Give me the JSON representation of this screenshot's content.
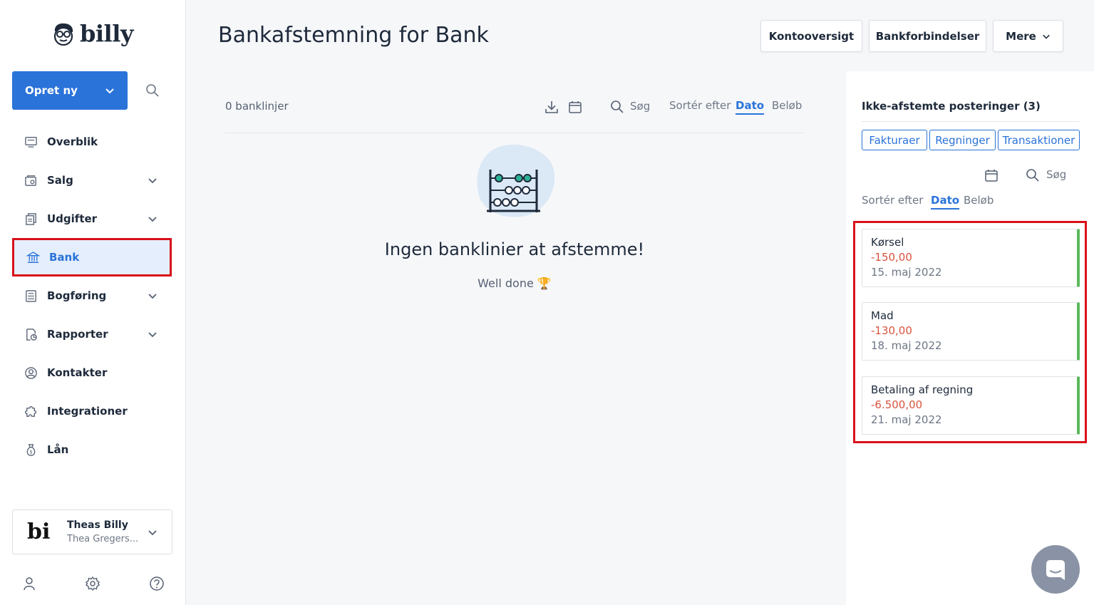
{
  "brand": {
    "name": "billy"
  },
  "sidebar": {
    "create_label": "Opret ny",
    "items": [
      {
        "label": "Overblik",
        "icon": "dashboard-icon",
        "expandable": false
      },
      {
        "label": "Salg",
        "icon": "sales-icon",
        "expandable": true
      },
      {
        "label": "Udgifter",
        "icon": "expenses-icon",
        "expandable": true
      },
      {
        "label": "Bank",
        "icon": "bank-icon",
        "expandable": false,
        "active": true
      },
      {
        "label": "Bogføring",
        "icon": "ledger-icon",
        "expandable": true
      },
      {
        "label": "Rapporter",
        "icon": "reports-icon",
        "expandable": true
      },
      {
        "label": "Kontakter",
        "icon": "contacts-icon",
        "expandable": false
      },
      {
        "label": "Integrationer",
        "icon": "puzzle-icon",
        "expandable": false
      },
      {
        "label": "Lån",
        "icon": "money-bag-icon",
        "expandable": false
      }
    ],
    "org": {
      "logo_text": "bi",
      "name": "Theas Billy",
      "user": "Thea Gregers..."
    }
  },
  "header": {
    "title": "Bankafstemning for Bank",
    "buttons": {
      "accounts": "Kontooversigt",
      "connections": "Bankforbindelser",
      "more": "Mere"
    }
  },
  "bank_lines": {
    "count_label": "0 banklinjer",
    "search_label": "Søg",
    "sort_label": "Sortér efter",
    "sort_options": [
      "Dato",
      "Beløb"
    ],
    "sort_active": "Dato",
    "empty_title": "Ingen banklinier at afstemme!",
    "empty_sub": "Well done 🏆"
  },
  "unreconciled": {
    "title": "Ikke-afstemte posteringer (3)",
    "filters": [
      "Fakturaer",
      "Regninger",
      "Transaktioner"
    ],
    "search_label": "Søg",
    "sort_label": "Sortér efter",
    "sort_options": [
      "Dato",
      "Beløb"
    ],
    "sort_active": "Dato",
    "entries": [
      {
        "title": "Kørsel",
        "amount": "-150,00",
        "date": "15. maj 2022"
      },
      {
        "title": "Mad",
        "amount": "-130,00",
        "date": "18. maj 2022"
      },
      {
        "title": "Betaling af regning",
        "amount": "-6.500,00",
        "date": "21. maj 2022"
      }
    ]
  },
  "colors": {
    "accent": "#2a73d9",
    "negative": "#d9533f",
    "highlight": "#d8111b",
    "success_bar": "#5cb85c"
  }
}
